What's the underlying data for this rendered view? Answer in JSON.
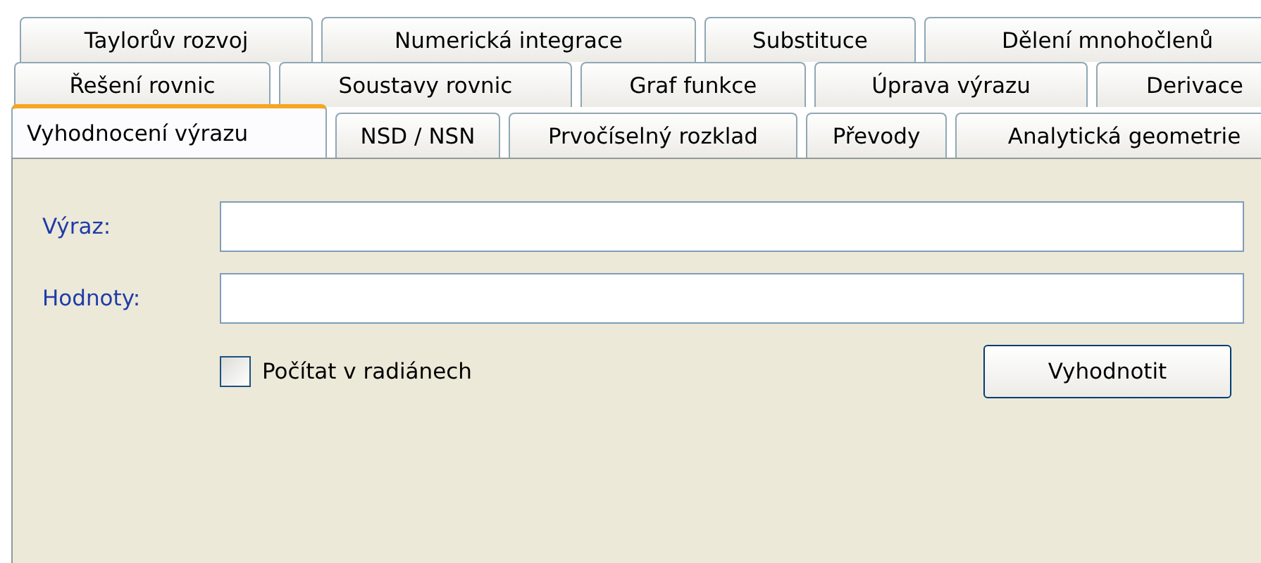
{
  "tab_rows": [
    [
      {
        "label": "Taylorův rozvoj",
        "selected": false
      },
      {
        "label": "Numerická integrace",
        "selected": false
      },
      {
        "label": "Substituce",
        "selected": false
      },
      {
        "label": "Dělení mnohočlenů",
        "selected": false
      }
    ],
    [
      {
        "label": "Řešení rovnic",
        "selected": false
      },
      {
        "label": "Soustavy rovnic",
        "selected": false
      },
      {
        "label": "Graf funkce",
        "selected": false
      },
      {
        "label": "Úprava výrazu",
        "selected": false
      },
      {
        "label": "Derivace",
        "selected": false
      }
    ],
    [
      {
        "label": "Vyhodnocení výrazu",
        "selected": true
      },
      {
        "label": "NSD / NSN",
        "selected": false
      },
      {
        "label": "Prvočíselný rozklad",
        "selected": false
      },
      {
        "label": "Převody",
        "selected": false
      },
      {
        "label": "Analytická geometrie",
        "selected": false
      }
    ]
  ],
  "fields": [
    {
      "label": "Výraz:"
    },
    {
      "label": "Hodnoty:"
    }
  ],
  "checkbox": {
    "label": "Počítat v radiánech",
    "checked": false
  },
  "button": "Vyhodnotit"
}
